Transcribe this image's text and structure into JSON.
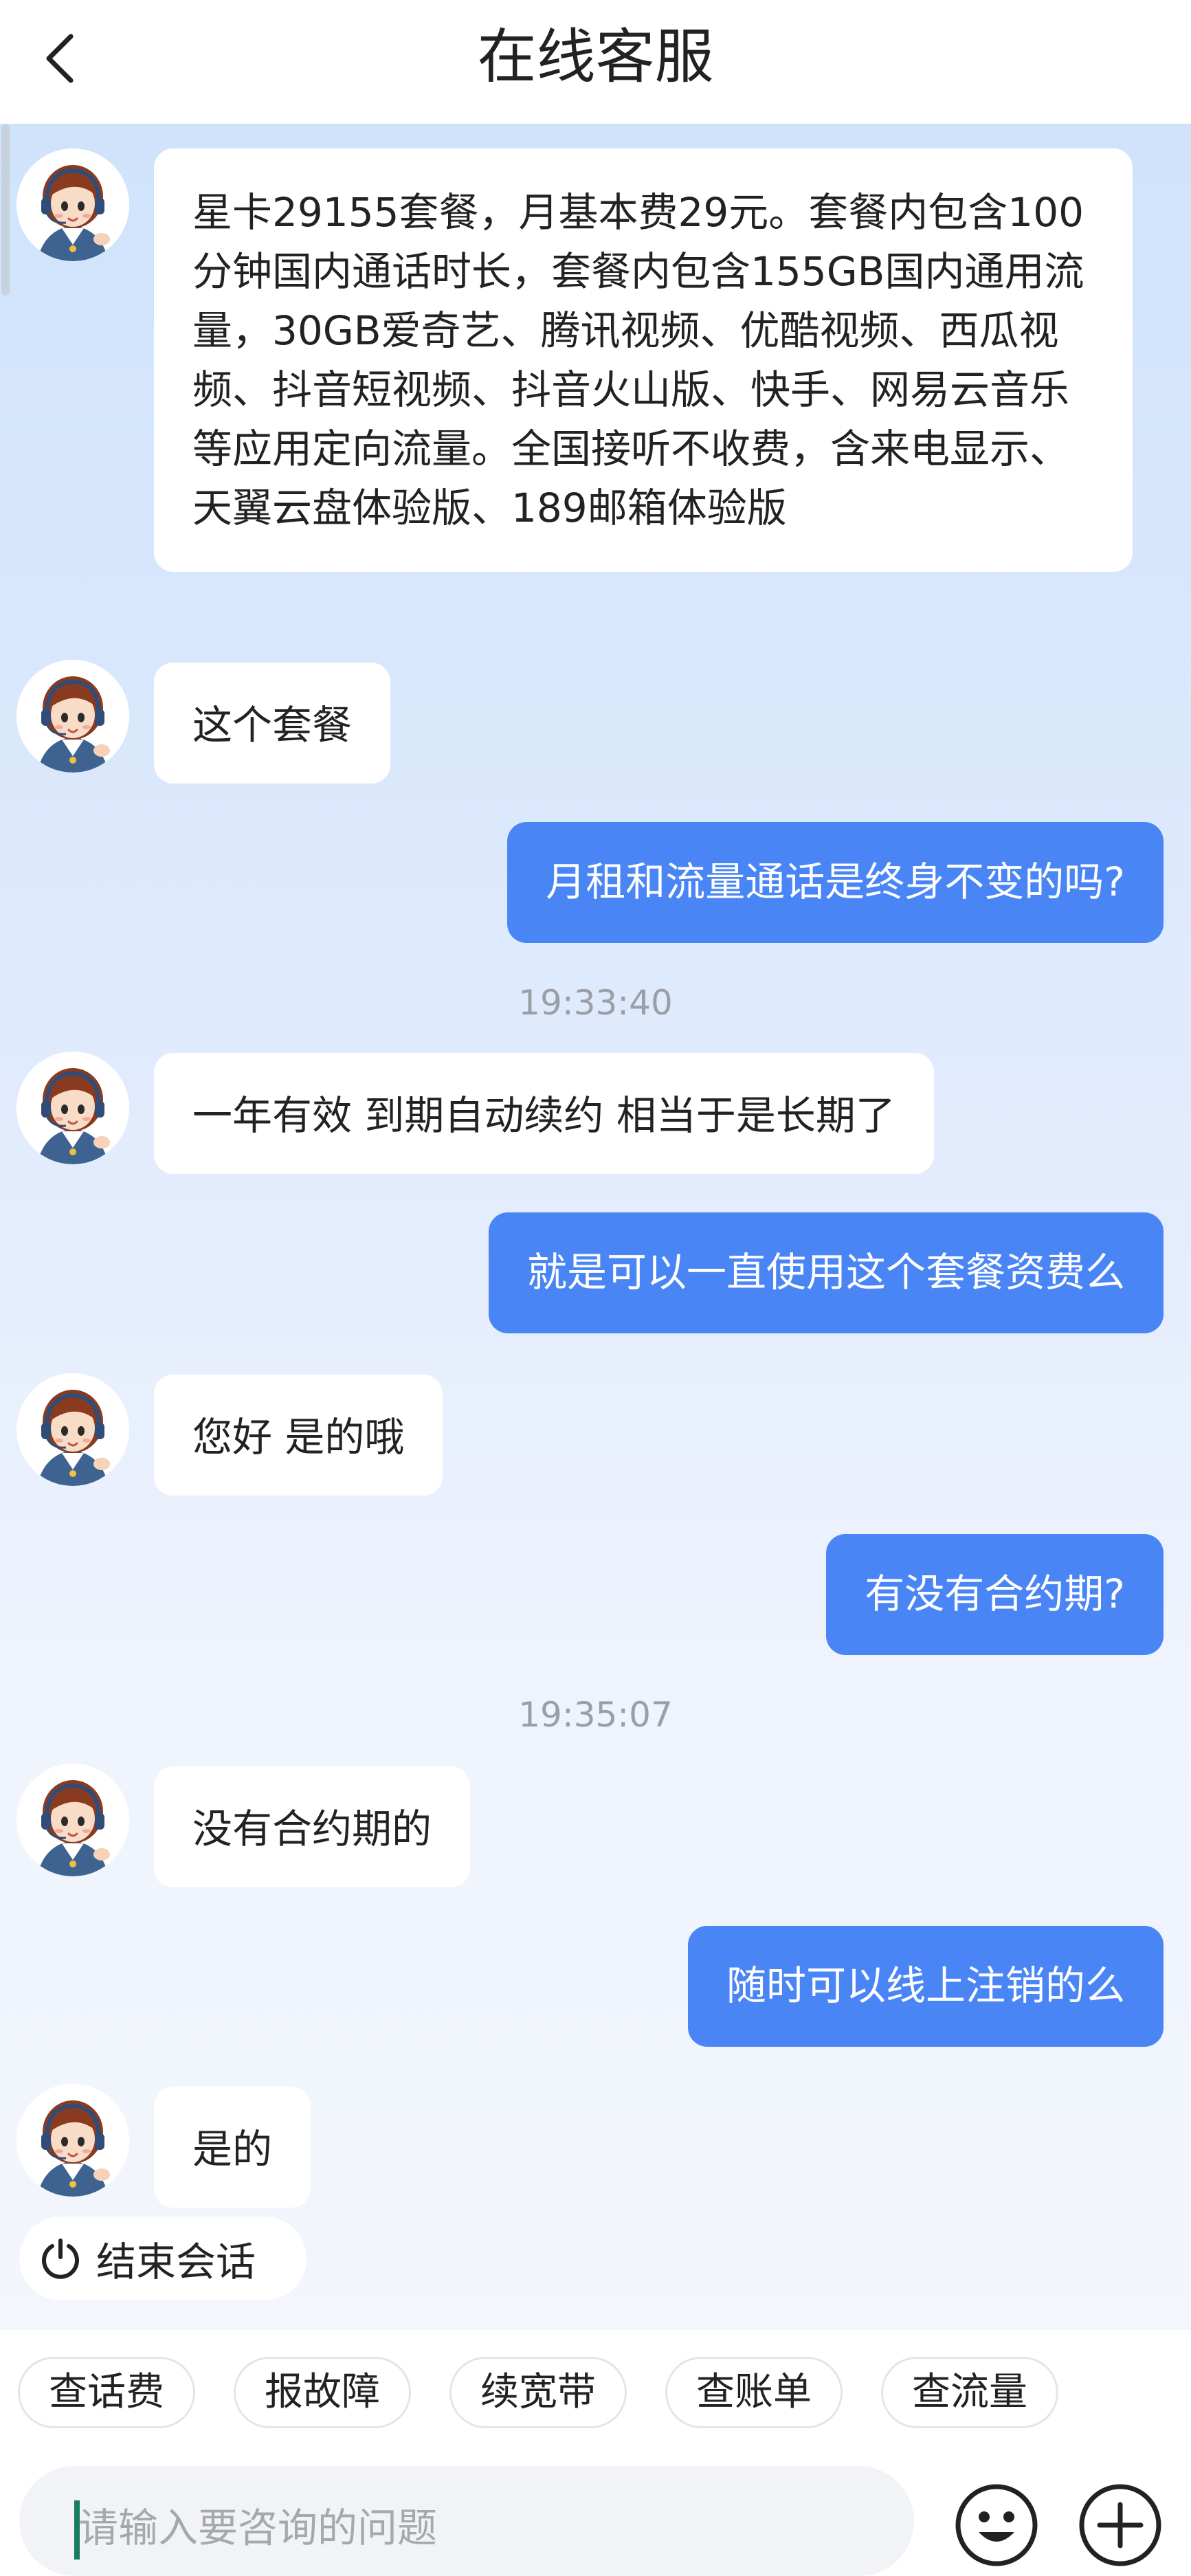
{
  "header": {
    "title": "在线客服",
    "back_icon": "chevron-left-icon"
  },
  "messages": [
    {
      "from": "agent",
      "text": "星卡29155套餐，月基本费29元。套餐内包含100分钟国内通话时长，套餐内包含155GB国内通用流量，30GB爱奇艺、腾讯视频、优酷视频、西瓜视频、抖音短视频、抖音火山版、快手、网易云音乐等应用定向流量。全国接听不收费，含来电显示、天翼云盘体验版、189邮箱体验版"
    },
    {
      "from": "agent",
      "text": "这个套餐"
    },
    {
      "from": "user",
      "text": "月租和流量通话是终身不变的吗?"
    },
    {
      "timestamp": "19:33:40"
    },
    {
      "from": "agent",
      "text": "一年有效 到期自动续约 相当于是长期了"
    },
    {
      "from": "user",
      "text": "就是可以一直使用这个套餐资费么"
    },
    {
      "from": "agent",
      "text": "您好 是的哦"
    },
    {
      "from": "user",
      "text": "有没有合约期?"
    },
    {
      "timestamp": "19:35:07"
    },
    {
      "from": "agent",
      "text": "没有合约期的"
    },
    {
      "from": "user",
      "text": "随时可以线上注销的么"
    },
    {
      "from": "agent",
      "text": "是的"
    }
  ],
  "end_session": {
    "label": "结束会话",
    "icon": "power-icon"
  },
  "quick_actions": [
    "查话费",
    "报故障",
    "续宽带",
    "查账单",
    "查流量"
  ],
  "input": {
    "placeholder": "请输入要咨询的问题",
    "value": ""
  },
  "toolbar_icons": [
    "emoji-icon",
    "plus-icon"
  ],
  "colors": {
    "user_bubble": "#4a85f6",
    "agent_bubble": "#ffffff",
    "chat_bg_top": "#cfe3fb",
    "chat_bg_bottom": "#f3f6fc"
  }
}
